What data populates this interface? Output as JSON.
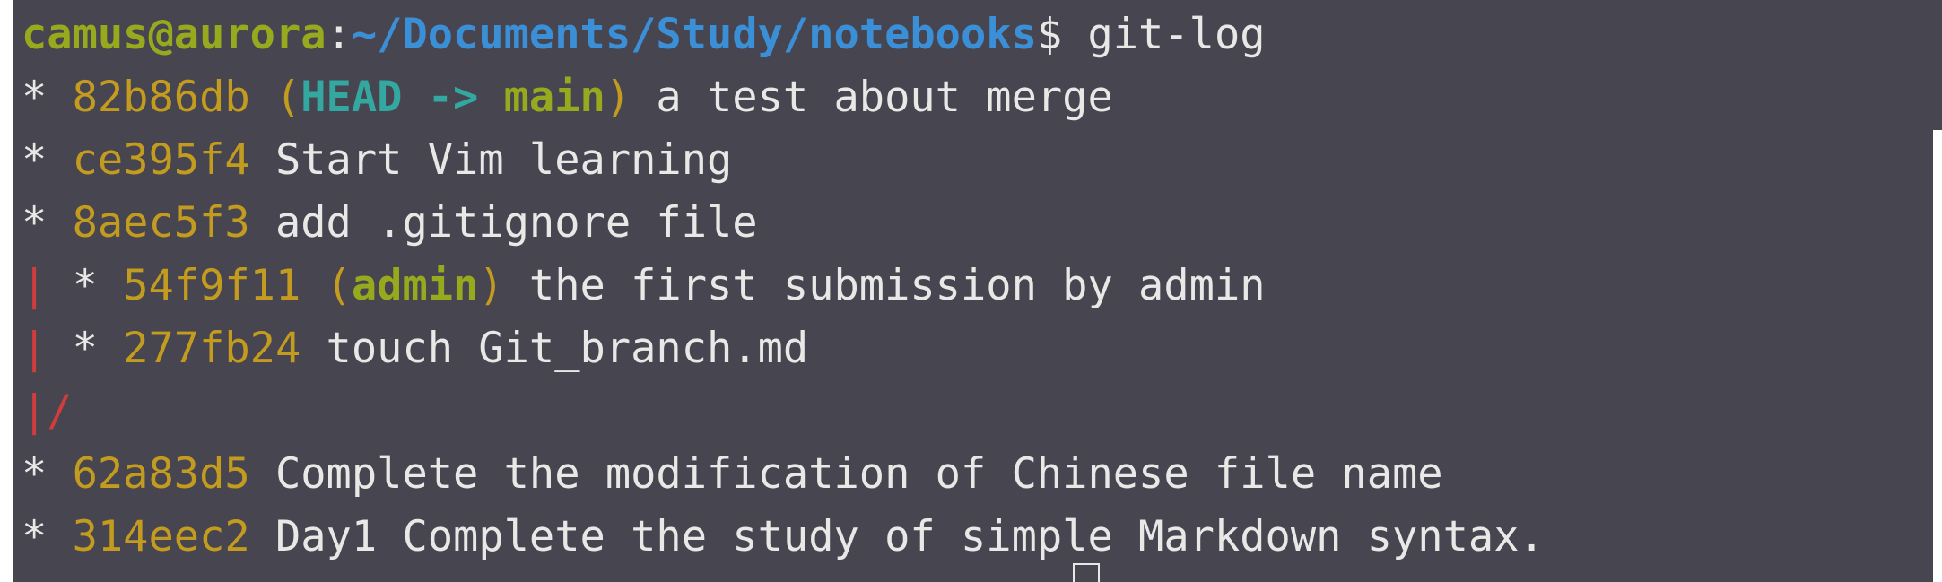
{
  "prompt": {
    "user_host": "camus@aurora",
    "separator": ":",
    "path": "~/Documents/Study/notebooks",
    "symbol": "$",
    "command": " git-log"
  },
  "log": [
    {
      "graph": "* ",
      "hash": "82b86db",
      "refs_open": " (",
      "head": "HEAD -> ",
      "branch": "main",
      "refs_close": ")",
      "message": " a test about merge"
    },
    {
      "graph": "* ",
      "hash": "ce395f4",
      "message": " Start Vim learning"
    },
    {
      "graph": "* ",
      "hash": "8aec5f3",
      "message": " add .gitignore file"
    },
    {
      "graph_bar": "|",
      "graph": " * ",
      "hash": "54f9f11",
      "refs_open": " (",
      "branch": "admin",
      "refs_close": ")",
      "message": " the first submission by admin"
    },
    {
      "graph_bar": "|",
      "graph": " * ",
      "hash": "277fb24",
      "message": " touch Git_branch.md"
    },
    {
      "graph_merge": "|/"
    },
    {
      "graph": "* ",
      "hash": "62a83d5",
      "message": " Complete the modification of Chinese file name"
    },
    {
      "graph": "* ",
      "hash": "314eec2",
      "message": " Day1 Complete the study of simple Markdown syntax."
    }
  ],
  "colors": {
    "background": "#474550",
    "user_host": "#97a91c",
    "path": "#3b8fd6",
    "hash": "#c29b1f",
    "head": "#33a8a0",
    "branch": "#97a91c",
    "graph_branch_line": "#d23c3c",
    "text": "#e8e8e6"
  }
}
